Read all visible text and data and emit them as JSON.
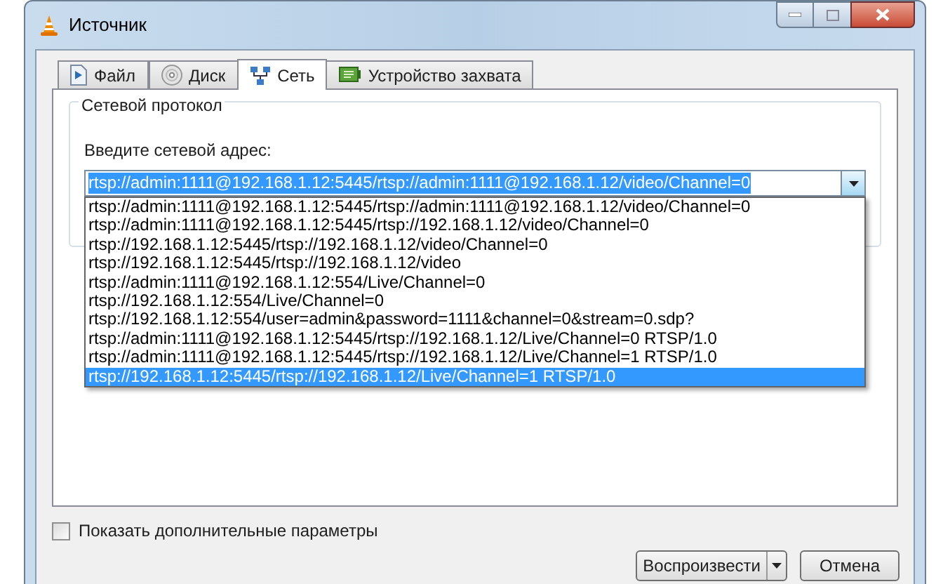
{
  "window": {
    "title": "Источник"
  },
  "tabs": [
    {
      "label": "Файл",
      "kind": "file",
      "selected": false
    },
    {
      "label": "Диск",
      "kind": "disc",
      "selected": false
    },
    {
      "label": "Сеть",
      "kind": "network",
      "selected": true
    },
    {
      "label": "Устройство захвата",
      "kind": "capture",
      "selected": false
    }
  ],
  "group": {
    "title": "Сетевой протокол",
    "label": "Введите сетевой адрес:"
  },
  "address_field": {
    "value": "rtsp://admin:1111@192.168.1.12:5445/rtsp://admin:1111@192.168.1.12/video/Channel=0"
  },
  "dropdown": [
    {
      "text": "rtsp://admin:1111@192.168.1.12:5445/rtsp://admin:1111@192.168.1.12/video/Channel=0",
      "selected": false
    },
    {
      "text": "rtsp://admin:1111@192.168.1.12:5445/rtsp://192.168.1.12/video/Channel=0",
      "selected": false
    },
    {
      "text": "rtsp://192.168.1.12:5445/rtsp://192.168.1.12/video/Channel=0",
      "selected": false
    },
    {
      "text": "rtsp://192.168.1.12:5445/rtsp://192.168.1.12/video",
      "selected": false
    },
    {
      "text": "rtsp://admin:1111@192.168.1.12:554/Live/Channel=0",
      "selected": false
    },
    {
      "text": "rtsp://192.168.1.12:554/Live/Channel=0",
      "selected": false
    },
    {
      "text": "rtsp://192.168.1.12:554/user=admin&password=1111&channel=0&stream=0.sdp?",
      "selected": false
    },
    {
      "text": "rtsp://admin:1111@192.168.1.12:5445/rtsp://192.168.1.12/Live/Channel=0 RTSP/1.0",
      "selected": false
    },
    {
      "text": "rtsp://admin:1111@192.168.1.12:5445/rtsp://192.168.1.12/Live/Channel=1 RTSP/1.0",
      "selected": false
    },
    {
      "text": "rtsp://192.168.1.12:5445/rtsp://192.168.1.12/Live/Channel=1 RTSP/1.0",
      "selected": true
    }
  ],
  "options_checkbox": {
    "label": "Показать дополнительные параметры",
    "checked": false
  },
  "buttons": [
    {
      "label": "Воспроизвести",
      "kind": "split"
    },
    {
      "label": "Отмена",
      "kind": "plain"
    }
  ]
}
